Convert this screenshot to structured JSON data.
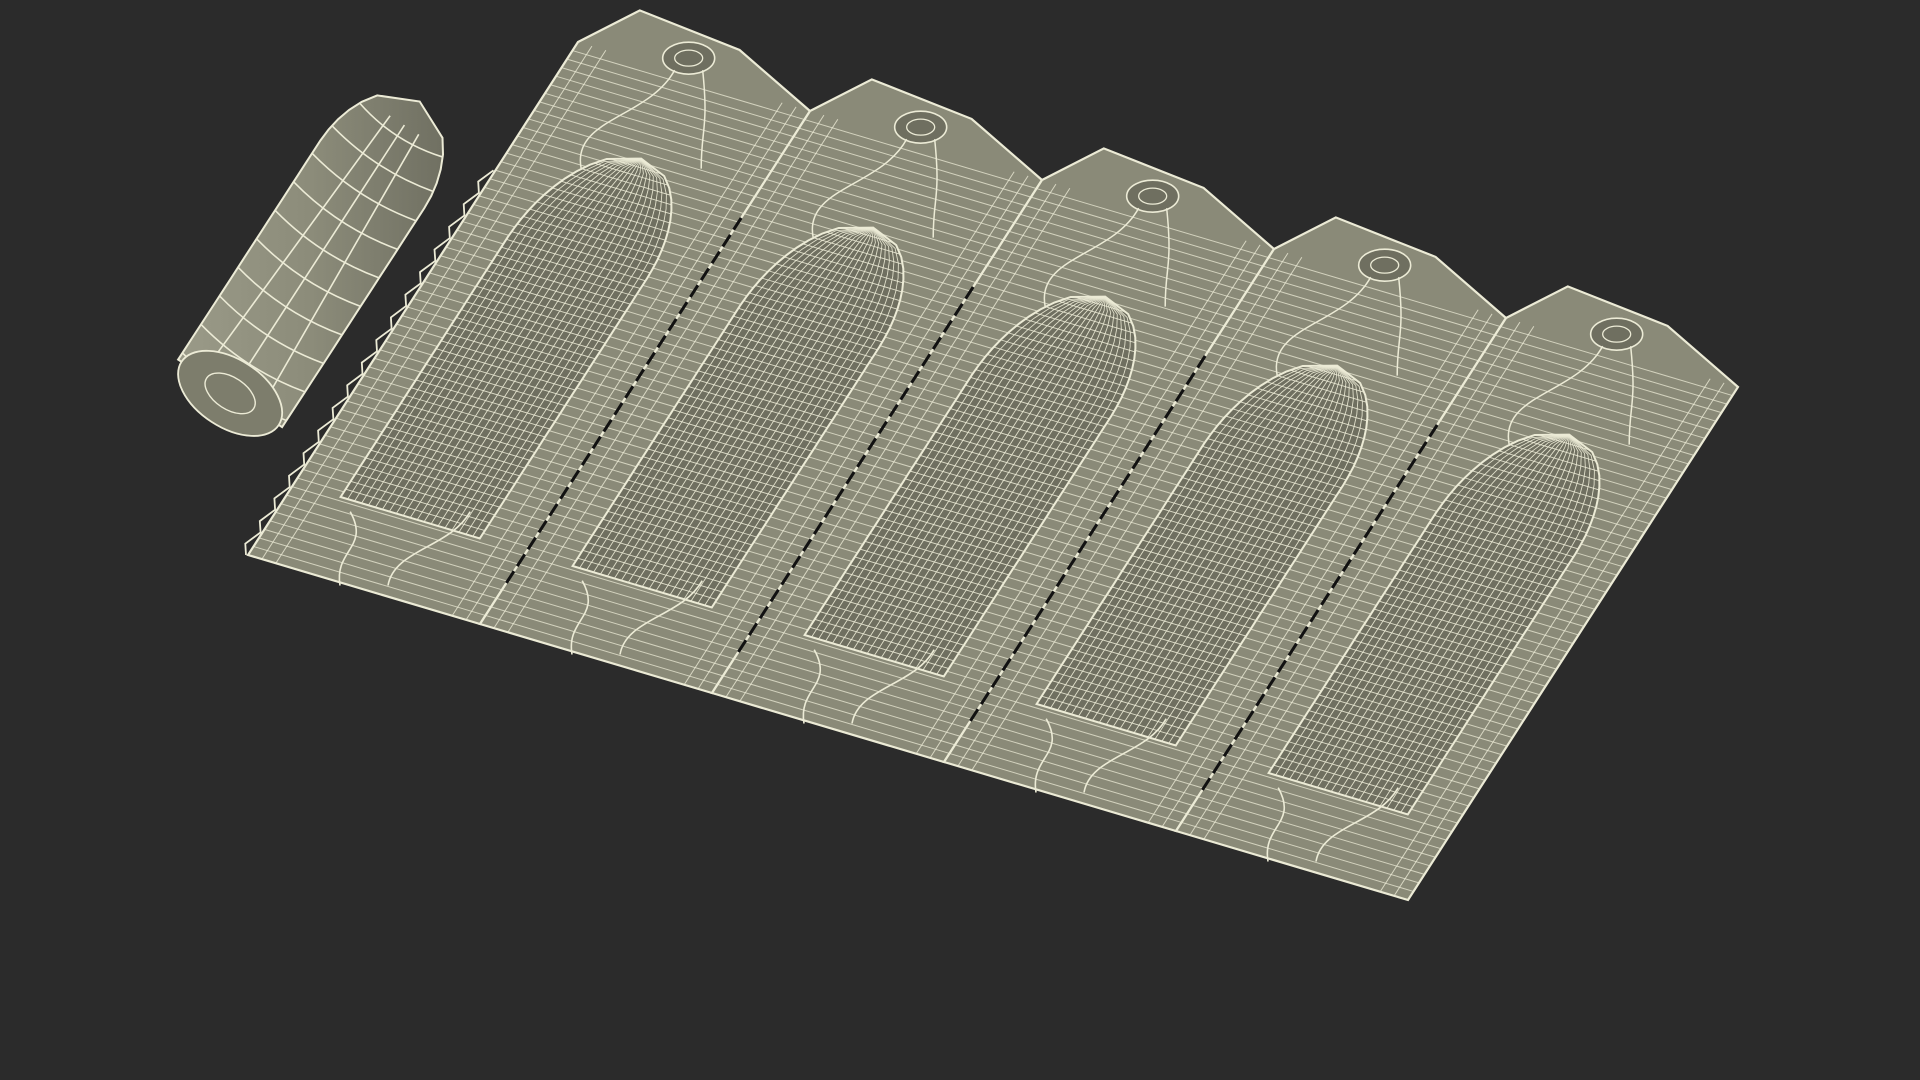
{
  "scene": {
    "colors": {
      "background": "#2b2b2b",
      "surface": "#8a8a78",
      "surface_dark": "#6f6f60",
      "wire": "#ecebd6"
    },
    "objects": [
      {
        "name": "suppository",
        "kind": "single-capsule"
      },
      {
        "name": "blister-strip",
        "kind": "tray",
        "cavity_count": 5
      }
    ]
  }
}
